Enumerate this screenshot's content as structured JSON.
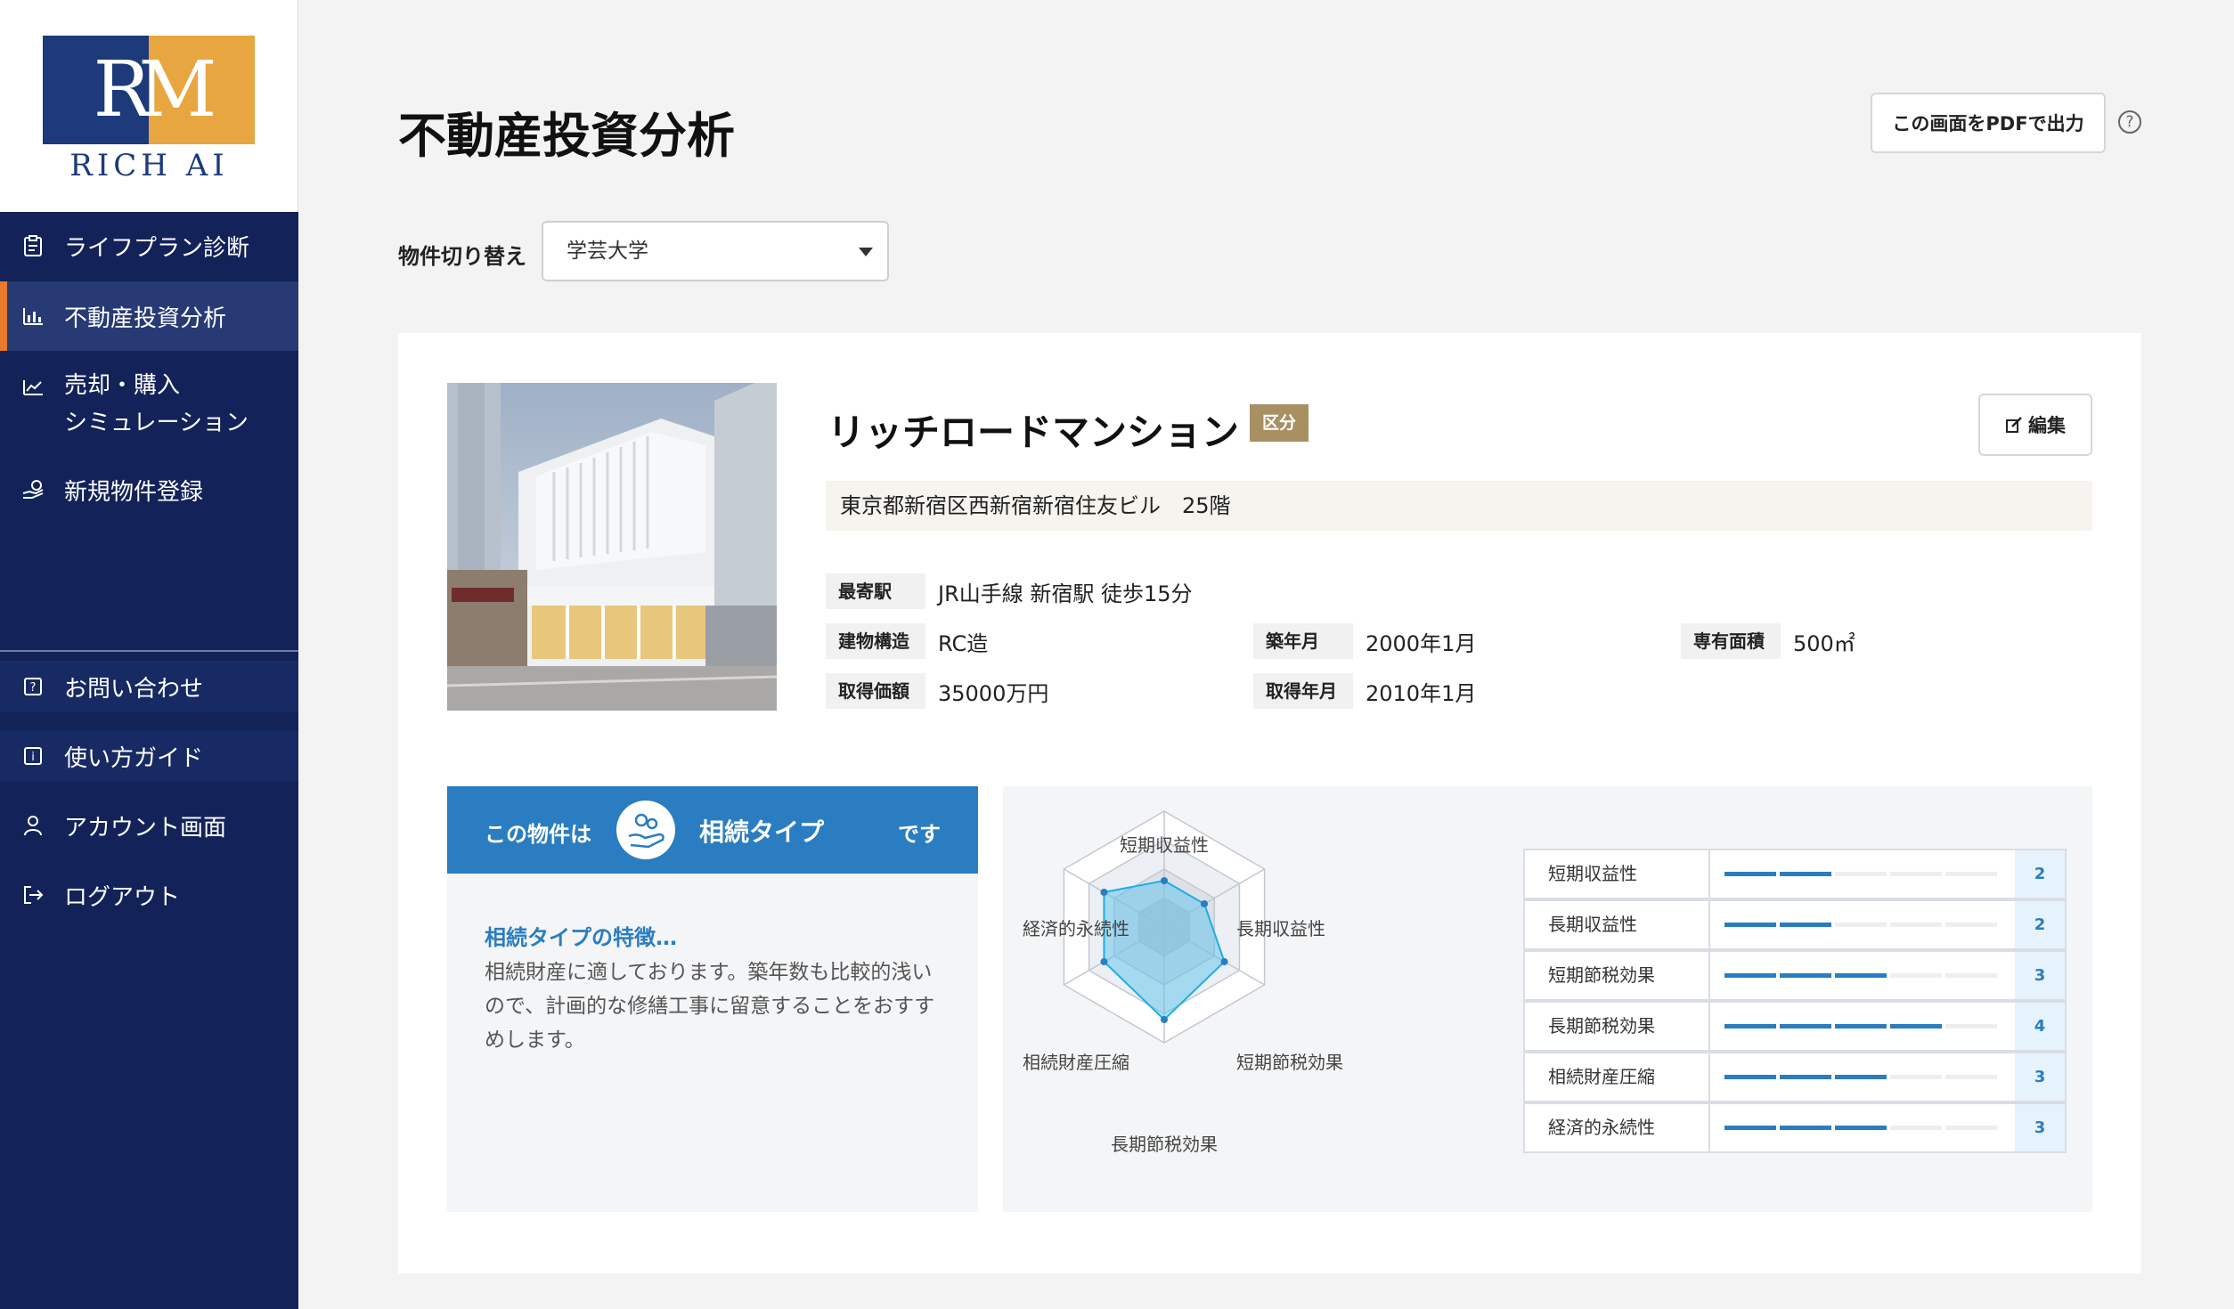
{
  "app": {
    "logo_text": "RICH AI"
  },
  "sidebar": {
    "items": [
      {
        "label": "ライフプラン診断",
        "icon": "clipboard-icon"
      },
      {
        "label": "不動産投資分析",
        "icon": "bar-chart-icon"
      },
      {
        "label": "売却・購入",
        "label2": "シミュレーション",
        "icon": "trend-up-icon"
      },
      {
        "label": "新規物件登録",
        "icon": "hand-coin-icon"
      }
    ],
    "bottom_items": [
      {
        "label": "お問い合わせ",
        "icon": "question-icon"
      },
      {
        "label": "使い方ガイド",
        "icon": "info-icon"
      },
      {
        "label": "アカウント画面",
        "icon": "user-icon"
      },
      {
        "label": "ログアウト",
        "icon": "logout-icon"
      }
    ]
  },
  "header": {
    "title": "不動産投資分析",
    "pdf_button": "この画面をPDFで出力",
    "switch_label": "物件切り替え",
    "switch_value": "学芸大学"
  },
  "property": {
    "name": "リッチロードマンション",
    "badge": "区分",
    "edit_label": "編集",
    "address": "東京都新宿区西新宿新宿住友ビル　25階",
    "station_key": "最寄駅",
    "station_val": "JR山手線 新宿駅 徒歩15分",
    "structure_key": "建物構造",
    "structure_val": "RC造",
    "built_key": "築年月",
    "built_val": "2000年1月",
    "area_key": "専有面積",
    "area_val": "500㎡",
    "price_key": "取得価額",
    "price_val": "35000万円",
    "acquired_key": "取得年月",
    "acquired_val": "2010年1月"
  },
  "type_panel": {
    "prefix": "この物件は",
    "type_name": "相続タイプ",
    "suffix": "です",
    "subtitle": "相続タイプの特徴…",
    "description": "相続財産に適しております。築年数も比較的浅いので、計画的な修繕工事に留意することをおすすめします。"
  },
  "colors": {
    "accent": "#2a7dc0",
    "sidebar": "#132259",
    "active_marker": "#e8792d",
    "badge": "#a89063"
  },
  "chart_data": {
    "type": "radar",
    "categories": [
      "短期収益性",
      "長期収益性",
      "短期節税効果",
      "長期節税効果",
      "相続財産圧縮",
      "経済的永続性"
    ],
    "values": [
      2,
      2,
      3,
      4,
      3,
      3
    ],
    "max": 5
  }
}
